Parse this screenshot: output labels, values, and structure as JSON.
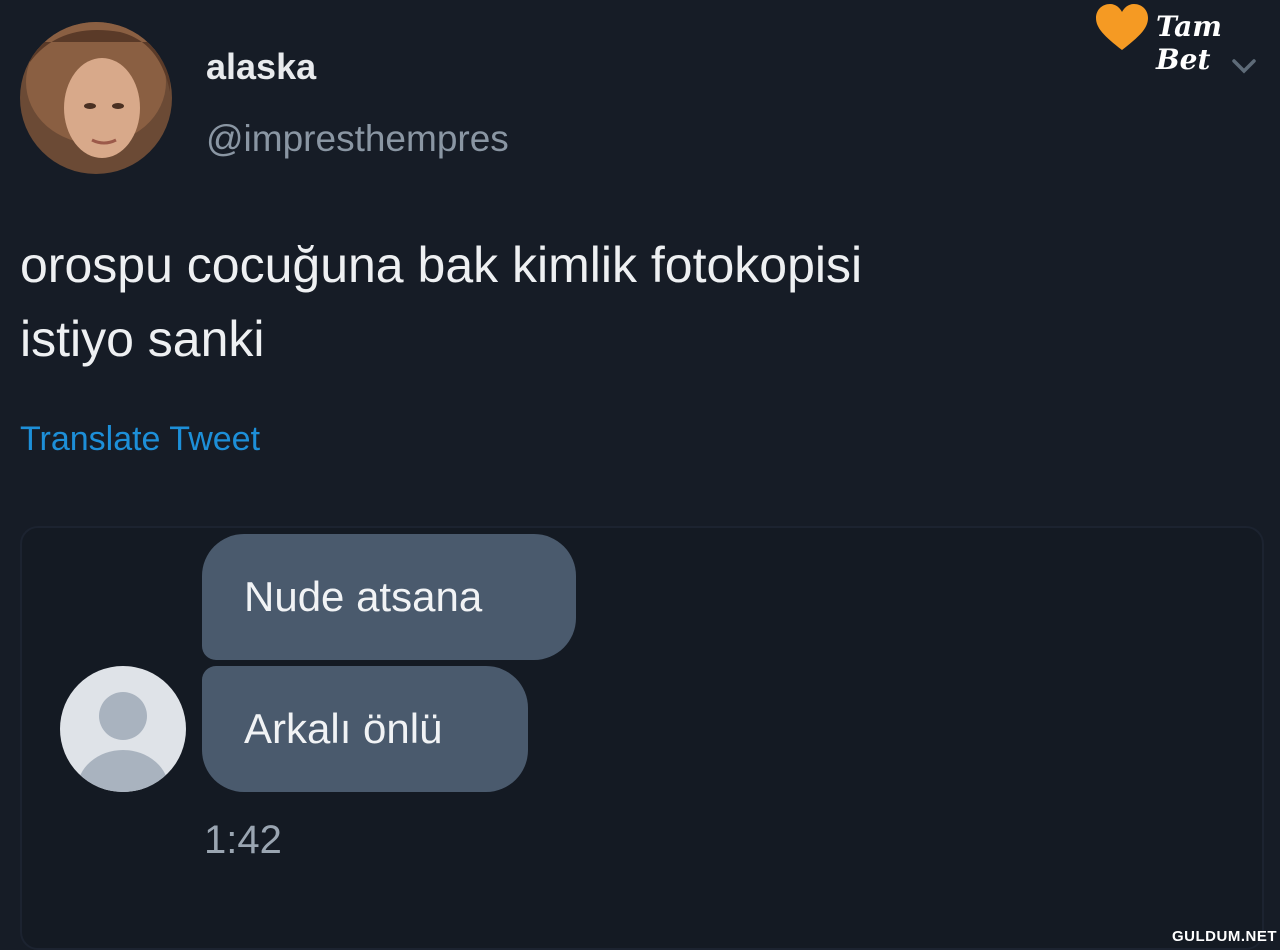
{
  "tweet": {
    "display_name": "alaska",
    "handle": "@impresthempres",
    "text_line1": "orospu cocuğuna bak kimlik fotokopisi",
    "text_line2": "istiyo sanki",
    "translate_label": "Translate Tweet"
  },
  "chat": {
    "messages": [
      {
        "text": "Nude atsana"
      },
      {
        "text": "Arkalı önlü"
      }
    ],
    "time": "1:42"
  },
  "brand": {
    "name": "Tam Bet",
    "color": "#f59a23"
  },
  "watermark": "GULDUM.NET",
  "icons": {
    "chevron": "chevron-down-icon",
    "heart": "heart-icon",
    "contact": "user-icon"
  }
}
